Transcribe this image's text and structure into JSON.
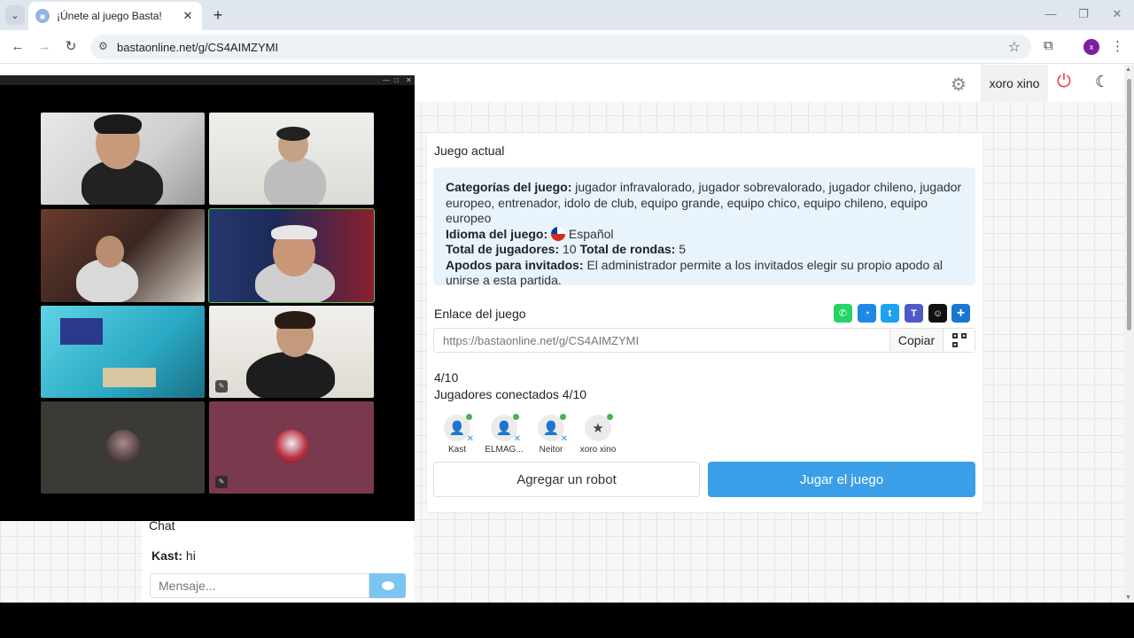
{
  "browser": {
    "tab_title": "¡Únete al juego Basta!",
    "url": "bastaonline.net/g/CS4AIMZYMI",
    "profile_initial": "x"
  },
  "topbar": {
    "username": "xoro xino"
  },
  "game": {
    "card_title": "Juego actual",
    "categories_label": "Categorías del juego:",
    "categories_value": "jugador infravalorado, jugador sobrevalorado, jugador chileno, jugador europeo, entrenador, idolo de club, equipo grande, equipo chico, equipo chileno, equipo europeo",
    "language_label": "Idioma del juego:",
    "language_value": "Español",
    "players_label": "Total de jugadores:",
    "players_value": "10",
    "rounds_label": "Total de rondas:",
    "rounds_value": "5",
    "nicknames_label": "Apodos para invitados:",
    "nicknames_value": "El administrador permite a los invitados elegir su propio apodo al unirse a esta partida.",
    "link_label": "Enlace del juego",
    "link_value": "https://bastaonline.net/g/CS4AIMZYMI",
    "copy_label": "Copiar",
    "count_short": "4/10",
    "connected_label": "Jugadores conectados 4/10",
    "players": [
      {
        "name": "Kast",
        "icon": "user-icon",
        "kickable": true
      },
      {
        "name": "ELMAG...",
        "icon": "user-icon",
        "kickable": true
      },
      {
        "name": "Neitor",
        "icon": "user-icon",
        "kickable": true
      },
      {
        "name": "xoro xino",
        "icon": "user-star-icon",
        "kickable": false
      }
    ],
    "add_robot_label": "Agregar un robot",
    "play_label": "Jugar el juego",
    "colors": {
      "play": "#3a9fe8",
      "info_bg": "#e8f3fc",
      "online": "#4caf50"
    }
  },
  "share": [
    {
      "name": "whatsapp-icon",
      "color": "#25d366",
      "glyph": "✆"
    },
    {
      "name": "messenger-icon",
      "color": "#1e88e5",
      "glyph": "◔"
    },
    {
      "name": "twitter-icon",
      "color": "#1da1f2",
      "glyph": "🐦"
    },
    {
      "name": "teams-icon",
      "color": "#5059c9",
      "glyph": "T"
    },
    {
      "name": "snapchat-icon",
      "color": "#111111",
      "glyph": "👻"
    },
    {
      "name": "share-more-icon",
      "color": "#1976d2",
      "glyph": "+"
    }
  ],
  "chat": {
    "title": "Chat",
    "messages": [
      {
        "author": "Kast:",
        "text": "hi"
      }
    ],
    "placeholder": "Mensaje..."
  }
}
